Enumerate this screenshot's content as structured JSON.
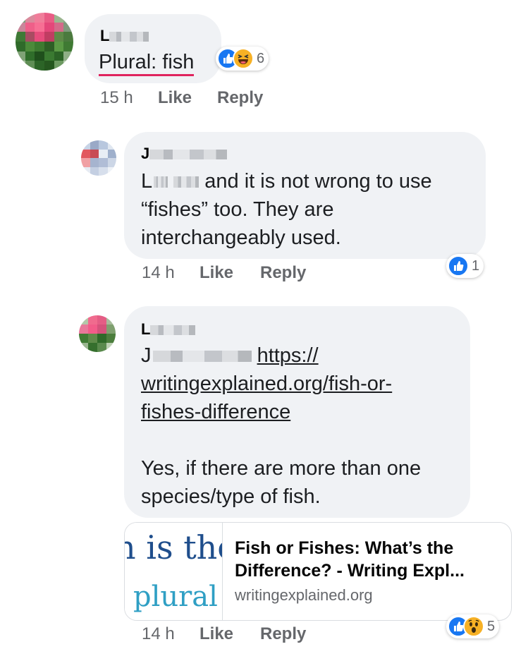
{
  "comments": [
    {
      "author_initial": "L",
      "text": "Plural: fish",
      "time": "15 h",
      "like_label": "Like",
      "reply_label": "Reply",
      "reactions": {
        "types": [
          "like",
          "haha"
        ],
        "count": "6"
      }
    },
    {
      "author_initial": "J",
      "mention_initial": "L",
      "text_lines": [
        "and it is not wrong to use",
        "“fishes” too. They are",
        "interchangeably used."
      ],
      "time": "14 h",
      "like_label": "Like",
      "reply_label": "Reply",
      "reactions": {
        "types": [
          "like"
        ],
        "count": "1"
      }
    },
    {
      "author_initial": "L",
      "mention_initial": "J",
      "link_lines": [
        "https://",
        "writingexplained.org/fish-or-",
        "fishes-difference"
      ],
      "text_lines": [
        "Yes, if there are more than one",
        "species/type of fish."
      ],
      "time": "14 h",
      "like_label": "Like",
      "reply_label": "Reply",
      "reactions": {
        "types": [
          "like",
          "wow"
        ],
        "count": "5"
      },
      "link_preview": {
        "thumb_line1": "n is the",
        "thumb_line2": "plural",
        "title": "Fish or Fishes: What’s the Difference? - Writing Expl...",
        "domain": "writingexplained.org"
      }
    }
  ],
  "colors": {
    "bubble": "#f0f2f5",
    "like_blue": "#1877f2",
    "emoji_yellow": "#f7b125",
    "meta_gray": "#65676b"
  }
}
